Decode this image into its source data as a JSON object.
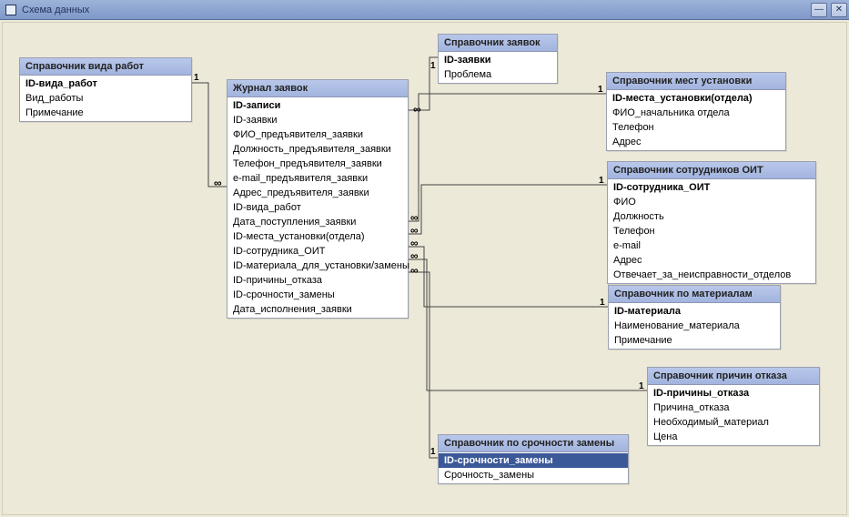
{
  "window": {
    "title": "Схема данных",
    "buttons": {
      "minimize": "—",
      "close": "✕"
    }
  },
  "tables": {
    "work_types": {
      "title": "Справочник вида работ",
      "fields": [
        {
          "name": "ID-вида_работ",
          "pk": true
        },
        {
          "name": "Вид_работы"
        },
        {
          "name": "Примечание"
        }
      ]
    },
    "journal": {
      "title": "Журнал заявок",
      "fields": [
        {
          "name": "ID-записи",
          "pk": true
        },
        {
          "name": "ID-заявки"
        },
        {
          "name": "ФИО_предъявителя_заявки"
        },
        {
          "name": "Должность_предъявителя_заявки"
        },
        {
          "name": "Телефон_предъявителя_заявки"
        },
        {
          "name": "e-mail_предъявителя_заявки"
        },
        {
          "name": "Адрес_предъявителя_заявки"
        },
        {
          "name": "ID-вида_работ"
        },
        {
          "name": "Дата_поступления_заявки"
        },
        {
          "name": "ID-места_установки(отдела)"
        },
        {
          "name": "ID-сотрудника_ОИТ"
        },
        {
          "name": "ID-материала_для_установки/замены"
        },
        {
          "name": "ID-причины_отказа"
        },
        {
          "name": "ID-срочности_замены"
        },
        {
          "name": "Дата_исполнения_заявки"
        }
      ]
    },
    "requests": {
      "title": "Справочник заявок",
      "fields": [
        {
          "name": "ID-заявки",
          "pk": true
        },
        {
          "name": "Проблема"
        }
      ]
    },
    "places": {
      "title": "Справочник мест установки",
      "fields": [
        {
          "name": "ID-места_установки(отдела)",
          "pk": true
        },
        {
          "name": "ФИО_начальника отдела"
        },
        {
          "name": "Телефон"
        },
        {
          "name": "Адрес"
        }
      ]
    },
    "staff": {
      "title": "Справочник сотрудников ОИТ",
      "fields": [
        {
          "name": "ID-сотрудника_ОИТ",
          "pk": true
        },
        {
          "name": "ФИО"
        },
        {
          "name": "Должность"
        },
        {
          "name": "Телефон"
        },
        {
          "name": "e-mail"
        },
        {
          "name": "Адрес"
        },
        {
          "name": "Отвечает_за_неисправности_отделов"
        }
      ]
    },
    "materials": {
      "title": "Справочник по материалам",
      "fields": [
        {
          "name": "ID-материала",
          "pk": true
        },
        {
          "name": "Наименование_материала"
        },
        {
          "name": "Примечание"
        }
      ]
    },
    "urgency": {
      "title": "Справочник по срочности замены",
      "fields": [
        {
          "name": "ID-срочности_замены",
          "pk": true,
          "selected": true
        },
        {
          "name": "Срочность_замены"
        }
      ]
    },
    "refusal": {
      "title": "Справочник причин отказа",
      "fields": [
        {
          "name": "ID-причины_отказа",
          "pk": true
        },
        {
          "name": "Причина_отказа"
        },
        {
          "name": "Необходимый_материал"
        },
        {
          "name": "Цена"
        }
      ]
    }
  },
  "relationships": [
    {
      "from": "work_types.ID-вида_работ",
      "to": "journal.ID-вида_работ",
      "type": "1:∞"
    },
    {
      "from": "requests.ID-заявки",
      "to": "journal.ID-заявки",
      "type": "1:∞"
    },
    {
      "from": "places.ID-места_установки(отдела)",
      "to": "journal.ID-места_установки(отдела)",
      "type": "1:∞"
    },
    {
      "from": "staff.ID-сотрудника_ОИТ",
      "to": "journal.ID-сотрудника_ОИТ",
      "type": "1:∞"
    },
    {
      "from": "materials.ID-материала",
      "to": "journal.ID-материала_для_установки/замены",
      "type": "1:∞"
    },
    {
      "from": "refusal.ID-причины_отказа",
      "to": "journal.ID-причины_отказа",
      "type": "1:∞"
    },
    {
      "from": "urgency.ID-срочности_замены",
      "to": "journal.ID-срочности_замены",
      "type": "1:∞"
    }
  ]
}
